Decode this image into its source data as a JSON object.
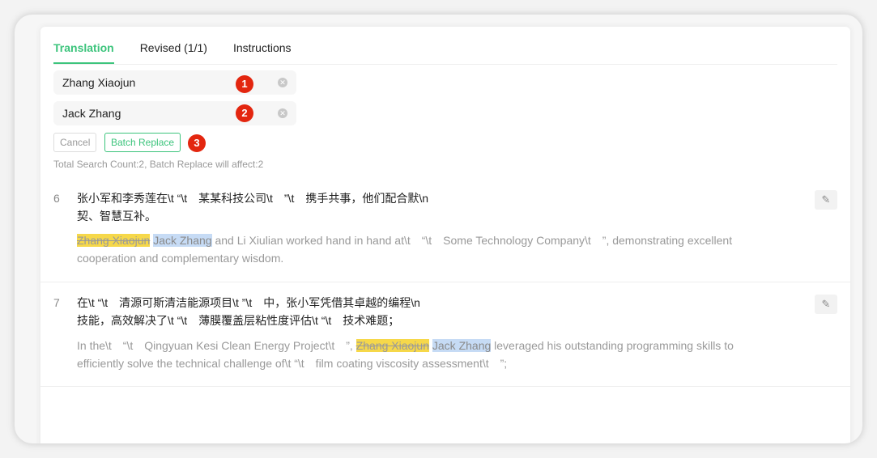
{
  "tabs": [
    {
      "label": "Translation",
      "active": true
    },
    {
      "label": "Revised (1/1)"
    },
    {
      "label": "Instructions"
    }
  ],
  "search": {
    "find_value": "Zhang Xiaojun",
    "replace_value": "Jack Zhang"
  },
  "badges": [
    "1",
    "2",
    "3"
  ],
  "buttons": {
    "cancel": "Cancel",
    "batch_replace": "Batch Replace"
  },
  "status": "Total Search Count:2,  Batch Replace will affect:2",
  "segments": [
    {
      "number": "6",
      "source_line1": "张小军和李秀莲在\\t “\\t　某某科技公司\\t　”\\t　携手共事，他们配合默\\n",
      "source_line2": "契、智慧互补。",
      "target_before": "",
      "old": "Zhang Xiaojun",
      "new": "Jack Zhang",
      "target_after": " and Li Xiulian worked hand in hand at\\t　“\\t　Some Technology Company\\t　”, demonstrating excellent cooperation and complementary wisdom."
    },
    {
      "number": "7",
      "source_line1": "在\\t “\\t　清源可斯清洁能源项目\\t ”\\t　中，张小军凭借其卓越的编程\\n",
      "source_line2": "技能，高效解决了\\t “\\t　薄膜覆盖层粘性度评估\\t “\\t　技术难题；",
      "target_before": "In the\\t　“\\t　Qingyuan Kesi Clean Energy Project\\t　”, ",
      "old": "Zhang Xiaojun",
      "new": "Jack Zhang",
      "target_after": " leveraged his outstanding programming skills to efficiently solve the technical challenge of\\t “\\t　film coating viscosity assessment\\t　”;"
    }
  ],
  "colors": {
    "accent": "#3cc47c",
    "badge": "#e3260f",
    "old_highlight": "#f6d84a",
    "new_highlight": "#c6dbf5"
  }
}
